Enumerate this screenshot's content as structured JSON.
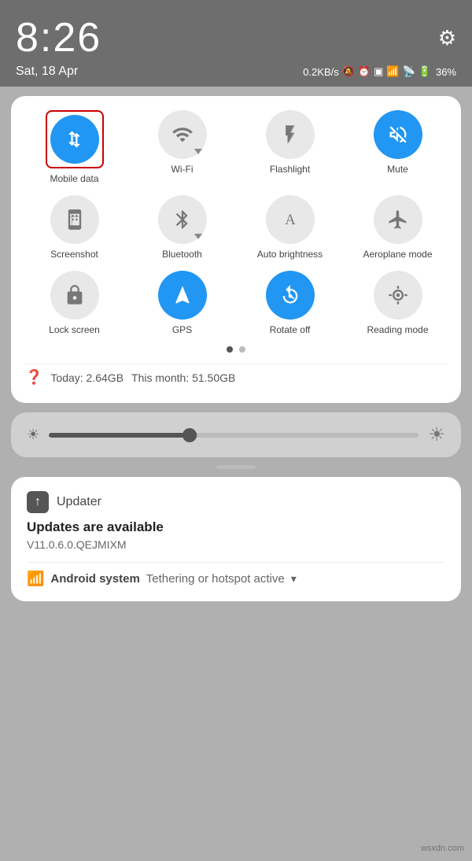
{
  "statusBar": {
    "time": "8:26",
    "date": "Sat, 18 Apr",
    "speed": "0.2KB/s",
    "battery": "36%"
  },
  "toggles": [
    {
      "id": "mobile-data",
      "label": "Mobile data",
      "active": true,
      "hasArrow": false
    },
    {
      "id": "wifi",
      "label": "Wi-Fi",
      "active": false,
      "hasArrow": true
    },
    {
      "id": "flashlight",
      "label": "Flashlight",
      "active": false,
      "hasArrow": false
    },
    {
      "id": "mute",
      "label": "Mute",
      "active": true,
      "hasArrow": false
    },
    {
      "id": "screenshot",
      "label": "Screenshot",
      "active": false,
      "hasArrow": false
    },
    {
      "id": "bluetooth",
      "label": "Bluetooth",
      "active": false,
      "hasArrow": true
    },
    {
      "id": "auto-brightness",
      "label": "Auto brightness",
      "active": false,
      "hasArrow": false
    },
    {
      "id": "aeroplane",
      "label": "Aeroplane mode",
      "active": false,
      "hasArrow": false
    },
    {
      "id": "lock-screen",
      "label": "Lock screen",
      "active": false,
      "hasArrow": false
    },
    {
      "id": "gps",
      "label": "GPS",
      "active": true,
      "hasArrow": false
    },
    {
      "id": "rotate-off",
      "label": "Rotate off",
      "active": true,
      "hasArrow": false
    },
    {
      "id": "reading-mode",
      "label": "Reading mode",
      "active": false,
      "hasArrow": false
    }
  ],
  "pagination": {
    "active": 0,
    "total": 2
  },
  "dataUsage": {
    "today": "Today: 2.64GB",
    "thisMonth": "This month: 51.50GB"
  },
  "updater": {
    "appName": "Updater",
    "title": "Updates are available",
    "version": "V11.0.6.0.QEJMIXM",
    "androidSystem": "Android system",
    "tethering": "Tethering or hotspot active"
  },
  "watermark": "wsxdn.com"
}
